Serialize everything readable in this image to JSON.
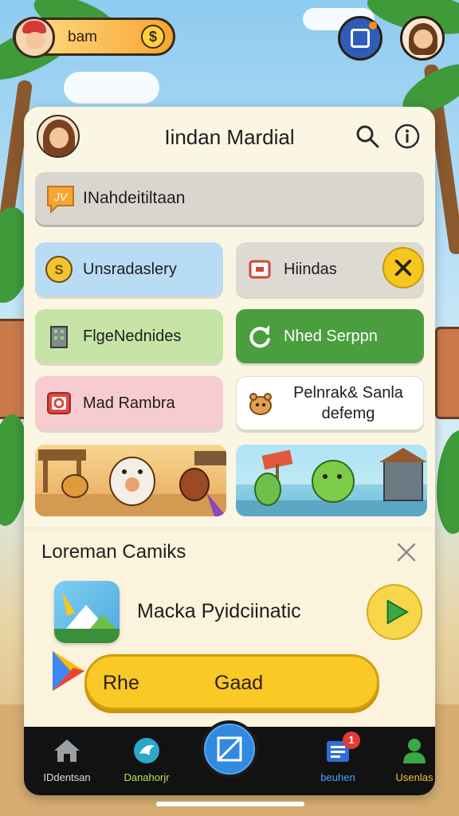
{
  "hud": {
    "player_name": "bam",
    "coin_symbol": "$"
  },
  "panel": {
    "title": "Iindan Mardial",
    "banner": {
      "label": "INahdeitiltaan",
      "icon_text": "JV"
    },
    "tiles": [
      {
        "label": "Unsradaslery",
        "icon": "coin-icon"
      },
      {
        "label": "Hiindas",
        "icon": "card-icon"
      },
      {
        "label": "FlgeNednides",
        "icon": "building-icon"
      },
      {
        "label": "Nhed Serppn",
        "icon": "refresh-icon"
      },
      {
        "label": "Mad Rambra",
        "icon": "camera-icon"
      },
      {
        "label": "Pelnrak& Sanla defemg",
        "icon": "creature-icon"
      }
    ]
  },
  "section": {
    "title": "Loreman Camiks",
    "app_name": "Macka Pyidciinatic",
    "button_left": "Rhe",
    "button_right": "Gaad"
  },
  "nav": {
    "items": [
      {
        "label": "IDdentsan",
        "color": "#dcdcdc"
      },
      {
        "label": "Danahorjr",
        "color": "#b6e35a"
      },
      {
        "label": "beuhen",
        "color": "#4aa3ff"
      },
      {
        "label": "Usenlas",
        "color": "#f2c233"
      }
    ],
    "badge_count": "1"
  },
  "colors": {
    "accent_yellow": "#f9c925",
    "accent_green": "#4a9e3e",
    "accent_blue": "#2f8ae0"
  }
}
